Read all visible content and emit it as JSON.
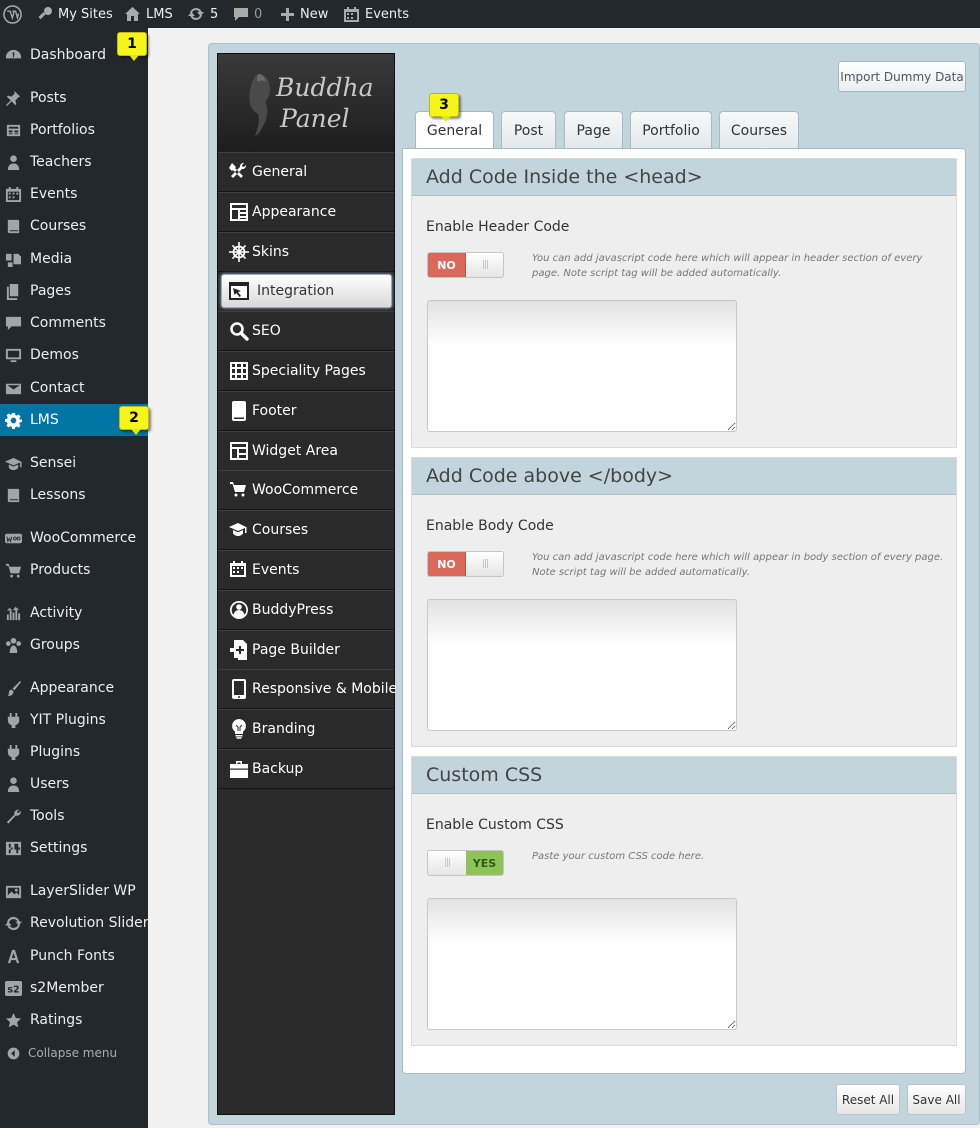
{
  "admin_bar": {
    "wp_logo_icon": "wordpress-icon",
    "my_sites": "My Sites",
    "site_name": "LMS",
    "updates_count": "5",
    "comments_count": "0",
    "new_label": "New",
    "events_label": "Events"
  },
  "sidebar": {
    "items": [
      {
        "label": "Dashboard",
        "icon": "dashboard-icon"
      },
      {
        "label": "Posts",
        "icon": "pin-icon"
      },
      {
        "label": "Portfolios",
        "icon": "portfolio-icon"
      },
      {
        "label": "Teachers",
        "icon": "user-icon"
      },
      {
        "label": "Events",
        "icon": "calendar-icon"
      },
      {
        "label": "Courses",
        "icon": "book-icon"
      },
      {
        "label": "Media",
        "icon": "media-icon"
      },
      {
        "label": "Pages",
        "icon": "pages-icon"
      },
      {
        "label": "Comments",
        "icon": "comment-icon"
      },
      {
        "label": "Demos",
        "icon": "monitor-icon"
      },
      {
        "label": "Contact",
        "icon": "mail-icon"
      },
      {
        "label": "LMS",
        "icon": "gear-icon"
      },
      {
        "label": "Sensei",
        "icon": "graduation-cap-icon"
      },
      {
        "label": "Lessons",
        "icon": "book-icon"
      },
      {
        "label": "WooCommerce",
        "icon": "woo-icon"
      },
      {
        "label": "Products",
        "icon": "cart-icon"
      },
      {
        "label": "Activity",
        "icon": "activity-icon"
      },
      {
        "label": "Groups",
        "icon": "groups-icon"
      },
      {
        "label": "Appearance",
        "icon": "brush-icon"
      },
      {
        "label": "YIT Plugins",
        "icon": "plugin-icon"
      },
      {
        "label": "Plugins",
        "icon": "plugin-icon"
      },
      {
        "label": "Users",
        "icon": "user-icon"
      },
      {
        "label": "Tools",
        "icon": "wrench-icon"
      },
      {
        "label": "Settings",
        "icon": "settings-icon"
      },
      {
        "label": "LayerSlider WP",
        "icon": "image-icon"
      },
      {
        "label": "Revolution Slider",
        "icon": "refresh-icon"
      },
      {
        "label": "Punch Fonts",
        "icon": "font-icon"
      },
      {
        "label": "s2Member",
        "icon": "s2-icon"
      },
      {
        "label": "Ratings",
        "icon": "star-icon"
      }
    ],
    "collapse_label": "Collapse menu",
    "active_item": "LMS"
  },
  "callouts": [
    "1",
    "2",
    "3"
  ],
  "panel": {
    "logo_text": [
      "Buddha",
      "Panel"
    ],
    "nav": [
      {
        "label": "General",
        "icon": "tools-icon"
      },
      {
        "label": "Appearance",
        "icon": "layout-icon"
      },
      {
        "label": "Skins",
        "icon": "ship-wheel-icon"
      },
      {
        "label": "Integration",
        "icon": "window-icon"
      },
      {
        "label": "SEO",
        "icon": "search-icon"
      },
      {
        "label": "Speciality Pages",
        "icon": "grid-icon"
      },
      {
        "label": "Footer",
        "icon": "tablet-icon"
      },
      {
        "label": "Widget Area",
        "icon": "widget-icon"
      },
      {
        "label": "WooCommerce",
        "icon": "cart-icon"
      },
      {
        "label": "Courses",
        "icon": "graduation-cap-icon"
      },
      {
        "label": "Events",
        "icon": "calendar-icon"
      },
      {
        "label": "BuddyPress",
        "icon": "buddypress-icon"
      },
      {
        "label": "Page Builder",
        "icon": "page-builder-icon"
      },
      {
        "label": "Responsive & Mobile",
        "icon": "mobile-icon"
      },
      {
        "label": "Branding",
        "icon": "bulb-icon"
      },
      {
        "label": "Backup",
        "icon": "briefcase-icon"
      }
    ],
    "active_nav": "Integration",
    "import_button": "Import Dummy Data",
    "tabs": [
      "General",
      "Post",
      "Page",
      "Portfolio",
      "Courses"
    ],
    "active_tab": "General",
    "sections": [
      {
        "title": "Add Code Inside the <head>",
        "field_label": "Enable Header Code",
        "toggle_label": "NO",
        "toggle_on": false,
        "hint": "You can add javascript code here which will appear in header section of every page. Note script tag will be added automatically.",
        "code": ""
      },
      {
        "title": "Add Code above </body>",
        "field_label": "Enable Body Code",
        "toggle_label": "NO",
        "toggle_on": false,
        "hint": "You can add javascript code here which will appear in body section of every page. Note script tag will be added automatically.",
        "code": ""
      },
      {
        "title": "Custom CSS",
        "field_label": "Enable Custom CSS",
        "toggle_label": "YES",
        "toggle_on": true,
        "hint": "Paste your custom CSS code here.",
        "code": ""
      }
    ],
    "reset_button": "Reset All",
    "save_button": "Save All"
  },
  "colors": {
    "admin_bar": "#23282d",
    "active_menu": "#0074a2",
    "panel_bg": "#c3d5dc",
    "toggle_off": "#d9695a",
    "toggle_on": "#8dc35a",
    "callout": "#f5f51a"
  }
}
